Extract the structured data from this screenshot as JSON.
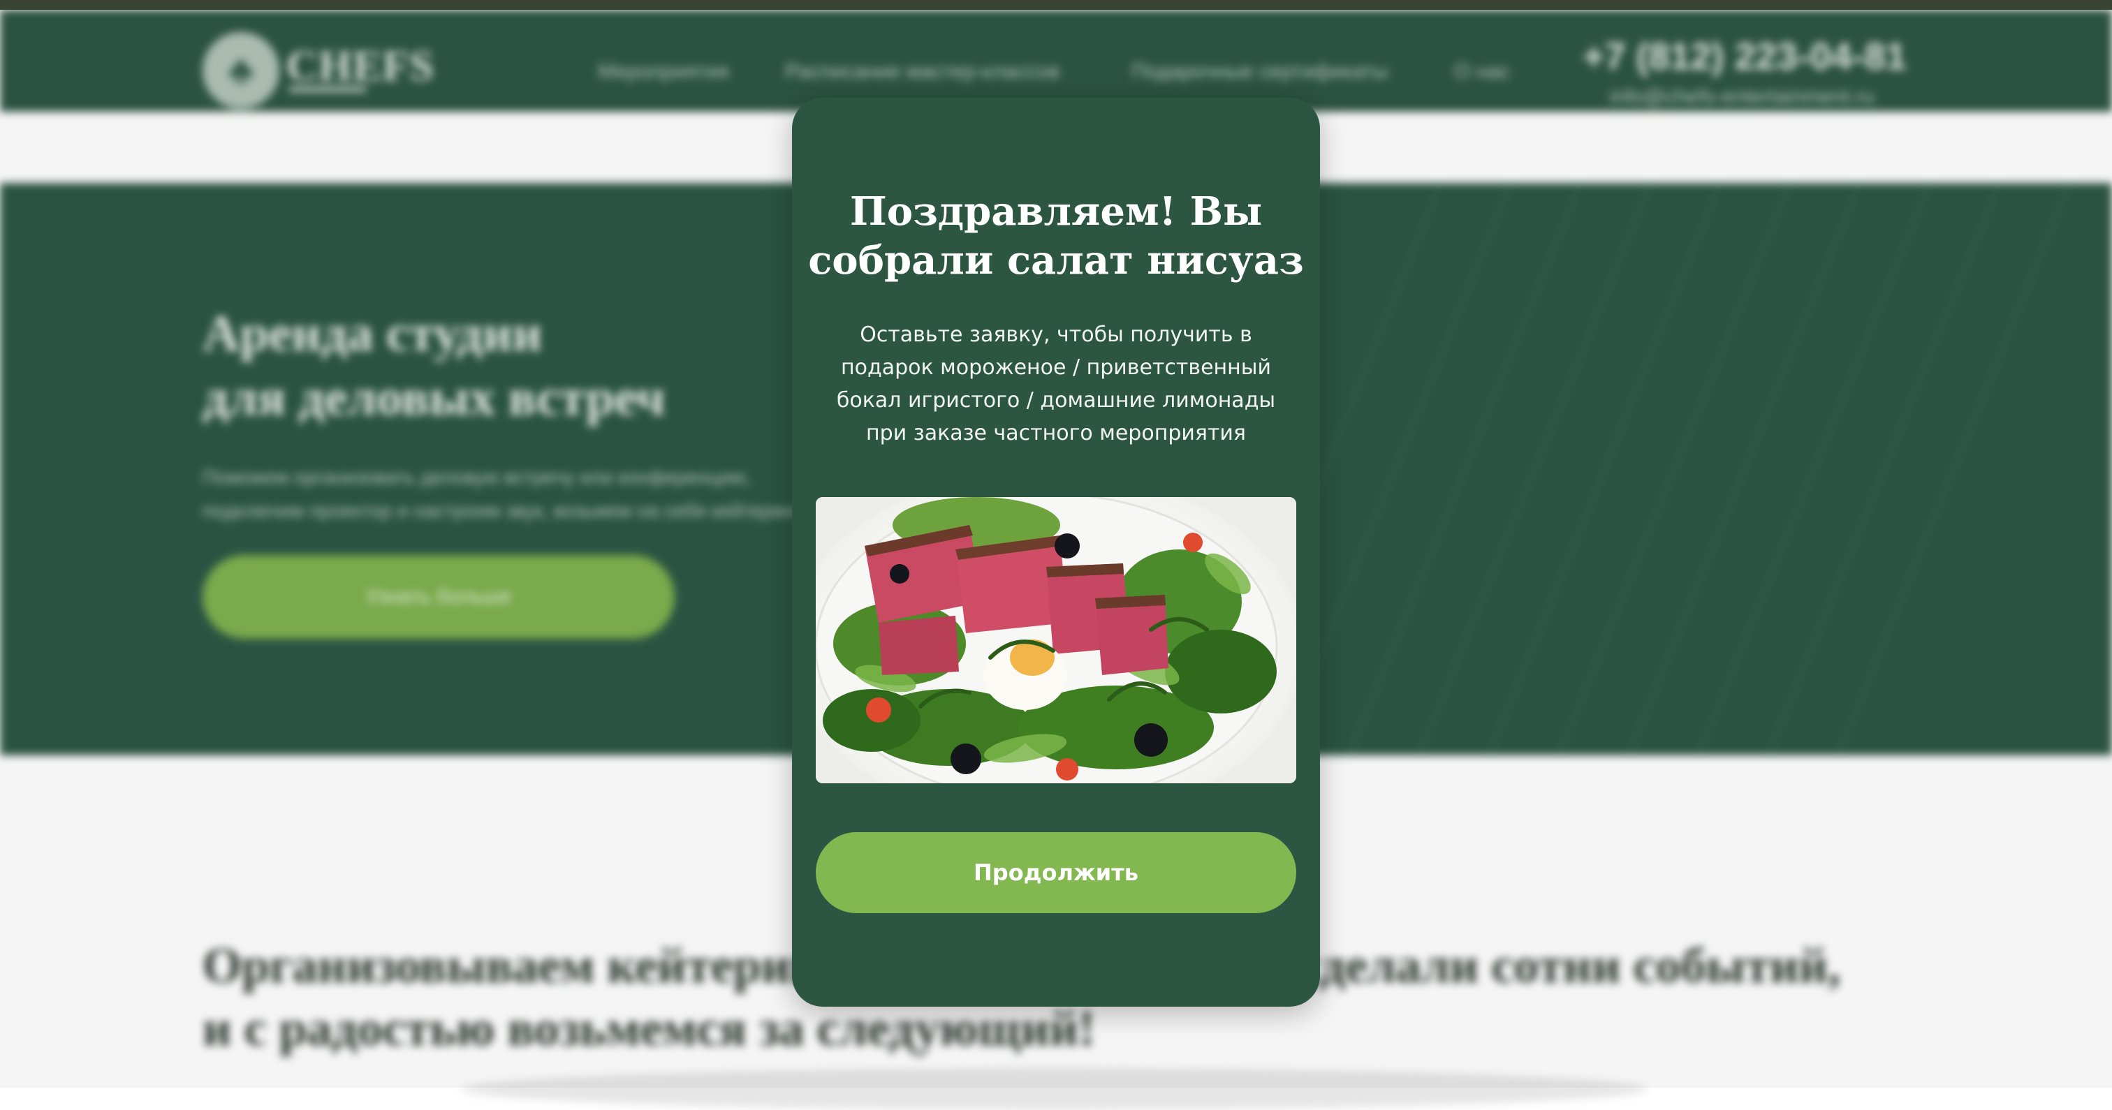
{
  "header": {
    "logo_text": "CHEFS",
    "nav_items": [
      "Мероприятия",
      "Расписание мастер-классов",
      "Подарочные сертификаты",
      "О нас"
    ],
    "phone": "+7 (812) 223-04-81",
    "email": "info@chefs-entertainment.ru"
  },
  "hero": {
    "title_line1": "Аренда студии",
    "title_line2": "для деловых встреч",
    "text": "Поможем организовать деловую встречу или конференцию, подключим проектор и настроим звук, возьмем на себя кейтеринг",
    "button": "Узнать больше"
  },
  "lower": {
    "title_line1": "Организовываем кейтеринг уже более 10 лет — сделали сотни событий,",
    "title_line2": "и с радостью возьмемся за следующий!"
  },
  "modal": {
    "title": "Поздравляем! Вы собрали салат нисуаз",
    "text": "Оставьте заявку, чтобы получить в подарок мороженое / приветственный бокал игристого / домашние лимонады при заказе частного мероприятия",
    "image_alt": "salad-nicoise-photo",
    "button": "Продолжить"
  },
  "colors": {
    "header_bg": "#2e5644",
    "modal_bg": "#2c5642",
    "accent_green": "#83b74f"
  }
}
